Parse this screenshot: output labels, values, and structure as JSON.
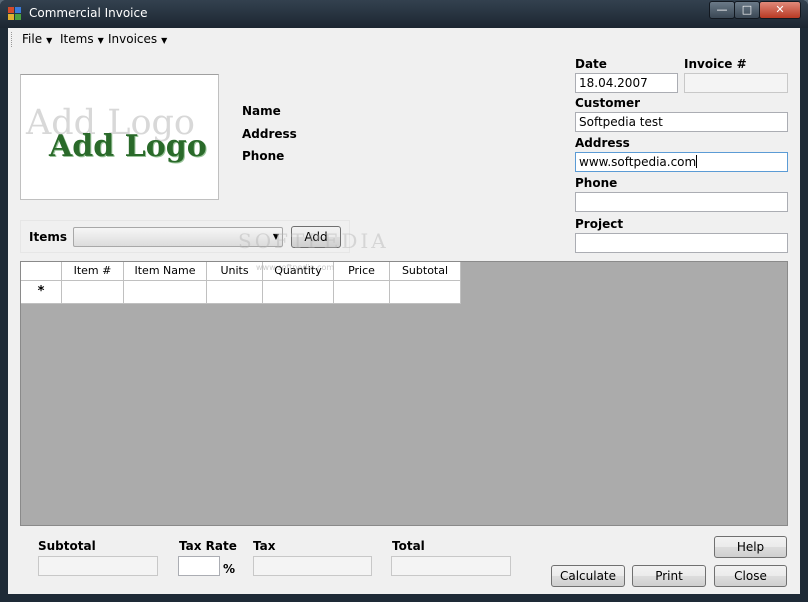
{
  "window": {
    "title": "Commercial Invoice"
  },
  "menu": [
    "File",
    "Items",
    "Invoices"
  ],
  "company_labels": {
    "name": "Name",
    "address": "Address",
    "phone": "Phone"
  },
  "logo": {
    "text": "Add Logo"
  },
  "form": {
    "date_label": "Date",
    "date_value": "18.04.2007",
    "invoice_label": "Invoice #",
    "invoice_value": "",
    "customer_label": "Customer",
    "customer_value": "Softpedia test",
    "address_label": "Address",
    "address_value": "www.softpedia.com",
    "phone_label": "Phone",
    "phone_value": "",
    "project_label": "Project",
    "project_value": ""
  },
  "items_bar": {
    "label": "Items",
    "selected": "",
    "add_label": "Add"
  },
  "grid": {
    "columns": [
      "Item #",
      "Item Name",
      "Units",
      "Quantity",
      "Price",
      "Subtotal"
    ],
    "new_row_marker": "*"
  },
  "totals": {
    "subtotal_label": "Subtotal",
    "tax_rate_label": "Tax Rate",
    "tax_rate_unit": "%",
    "tax_label": "Tax",
    "total_label": "Total"
  },
  "buttons": {
    "help": "Help",
    "calculate": "Calculate",
    "print": "Print",
    "close": "Close"
  },
  "watermark": {
    "text": "SOFTPEDIA",
    "small": "www.softpedia.com"
  }
}
